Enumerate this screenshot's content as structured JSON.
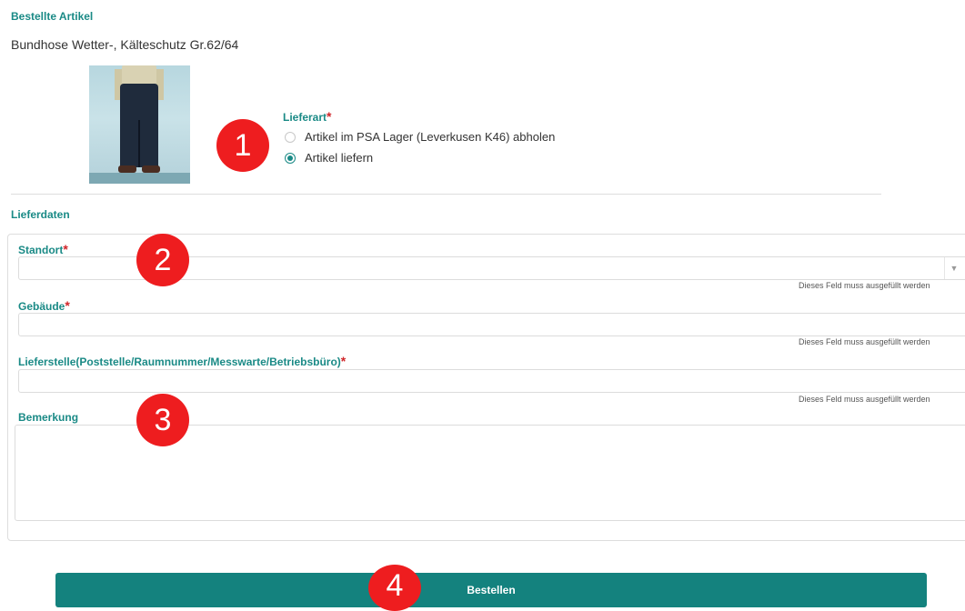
{
  "order": {
    "section_title": "Bestellte Artikel",
    "article_name": "Bundhose Wetter-, Kälteschutz Gr.62/64"
  },
  "delivery_type": {
    "label": "Lieferart",
    "required_mark": "*",
    "options": [
      {
        "label": "Artikel im PSA Lager (Leverkusen K46) abholen",
        "selected": false
      },
      {
        "label": "Artikel liefern",
        "selected": true
      }
    ]
  },
  "delivery_data": {
    "section_title": "Lieferdaten",
    "fields": {
      "standort": {
        "label": "Standort",
        "required_mark": "*",
        "value": "",
        "validation": "Dieses Feld muss ausgefüllt werden"
      },
      "gebaeude": {
        "label": "Gebäude",
        "required_mark": "*",
        "value": "",
        "validation": "Dieses Feld muss ausgefüllt werden"
      },
      "lieferstelle": {
        "label": "Lieferstelle(Poststelle/Raumnummer/Messwarte/Betriebsbüro)",
        "required_mark": "*",
        "value": "",
        "validation": "Dieses Feld muss ausgefüllt werden"
      },
      "bemerkung": {
        "label": "Bemerkung",
        "value": ""
      }
    },
    "dropdown_icon": "chevron-down-icon"
  },
  "actions": {
    "submit_label": "Bestellen"
  },
  "markers": [
    "1",
    "2",
    "3",
    "4"
  ],
  "colors": {
    "accent": "#1a8a86",
    "button": "#14827e",
    "required": "#d0262a",
    "marker": "#ee1d1f"
  }
}
